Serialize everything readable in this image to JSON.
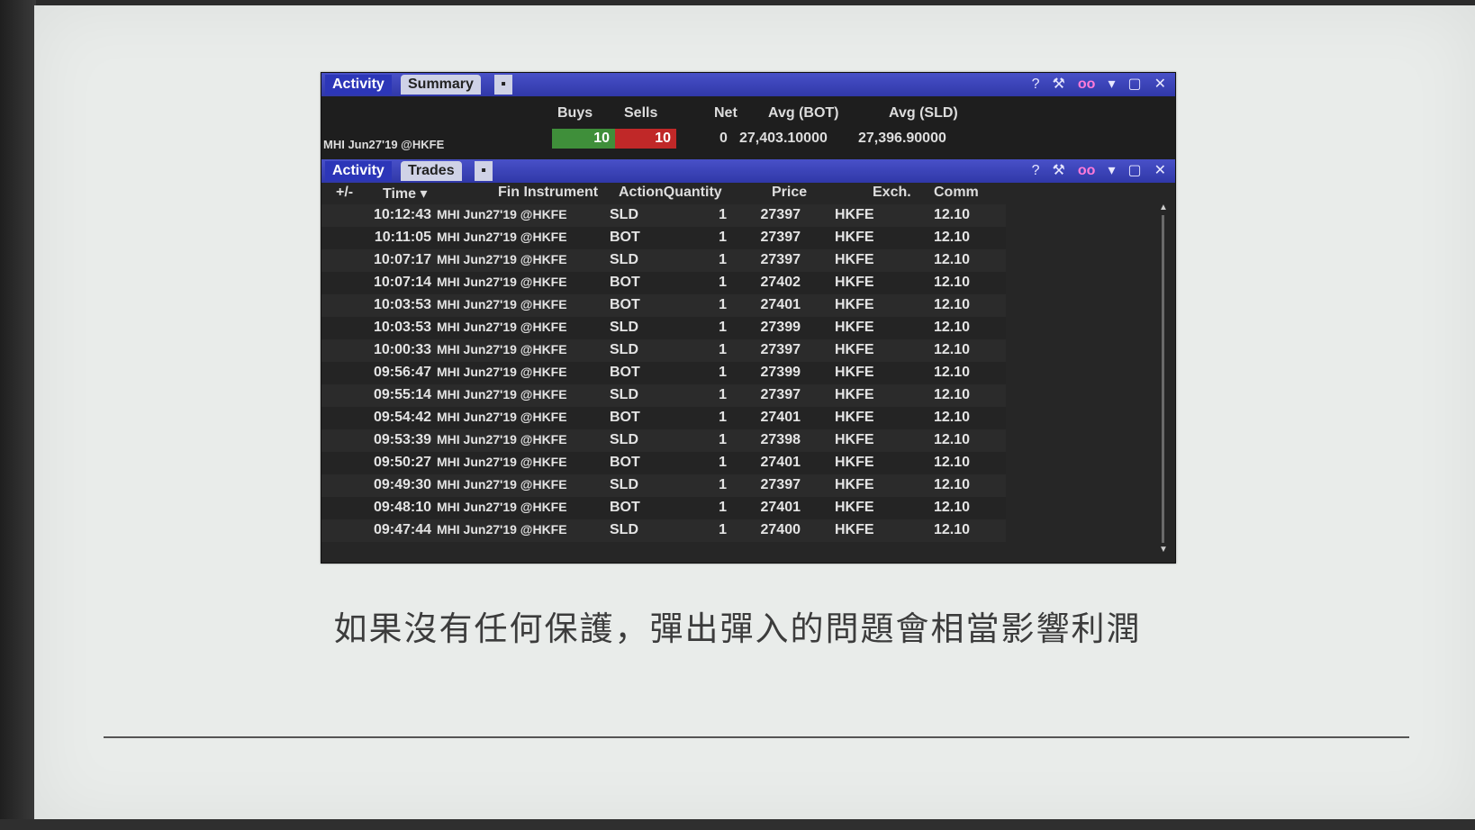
{
  "summary_panel": {
    "tabs": [
      "Activity",
      "Summary"
    ],
    "columns": {
      "buys": "Buys",
      "sells": "Sells",
      "net": "Net",
      "avg_bot": "Avg (BOT)",
      "avg_sld": "Avg (SLD)"
    },
    "row": {
      "instrument": "MHI Jun27'19 @HKFE",
      "buys": "10",
      "sells": "10",
      "net": "0",
      "avg_bot": "27,403.10000",
      "avg_sld": "27,396.90000"
    }
  },
  "header_icons": {
    "help": "?",
    "wrench": "🔧",
    "link": "oo",
    "dropdown": "▾",
    "expand": "⛶",
    "close": "✕"
  },
  "trades_panel": {
    "tabs": [
      "Activity",
      "Trades"
    ],
    "columns": {
      "pm": "+/-",
      "time": "Time ▾",
      "instrument": "Fin Instrument",
      "action_qty": "ActionQuantity",
      "price": "Price",
      "exch": "Exch.",
      "comm": "Comm"
    },
    "rows": [
      {
        "time": "10:12:43",
        "instrument": "MHI Jun27'19 @HKFE",
        "action": "SLD",
        "qty": "1",
        "price": "27397",
        "exch": "HKFE",
        "comm": "12.10"
      },
      {
        "time": "10:11:05",
        "instrument": "MHI Jun27'19 @HKFE",
        "action": "BOT",
        "qty": "1",
        "price": "27397",
        "exch": "HKFE",
        "comm": "12.10"
      },
      {
        "time": "10:07:17",
        "instrument": "MHI Jun27'19 @HKFE",
        "action": "SLD",
        "qty": "1",
        "price": "27397",
        "exch": "HKFE",
        "comm": "12.10"
      },
      {
        "time": "10:07:14",
        "instrument": "MHI Jun27'19 @HKFE",
        "action": "BOT",
        "qty": "1",
        "price": "27402",
        "exch": "HKFE",
        "comm": "12.10"
      },
      {
        "time": "10:03:53",
        "instrument": "MHI Jun27'19 @HKFE",
        "action": "BOT",
        "qty": "1",
        "price": "27401",
        "exch": "HKFE",
        "comm": "12.10"
      },
      {
        "time": "10:03:53",
        "instrument": "MHI Jun27'19 @HKFE",
        "action": "SLD",
        "qty": "1",
        "price": "27399",
        "exch": "HKFE",
        "comm": "12.10"
      },
      {
        "time": "10:00:33",
        "instrument": "MHI Jun27'19 @HKFE",
        "action": "SLD",
        "qty": "1",
        "price": "27397",
        "exch": "HKFE",
        "comm": "12.10"
      },
      {
        "time": "09:56:47",
        "instrument": "MHI Jun27'19 @HKFE",
        "action": "BOT",
        "qty": "1",
        "price": "27399",
        "exch": "HKFE",
        "comm": "12.10"
      },
      {
        "time": "09:55:14",
        "instrument": "MHI Jun27'19 @HKFE",
        "action": "SLD",
        "qty": "1",
        "price": "27397",
        "exch": "HKFE",
        "comm": "12.10"
      },
      {
        "time": "09:54:42",
        "instrument": "MHI Jun27'19 @HKFE",
        "action": "BOT",
        "qty": "1",
        "price": "27401",
        "exch": "HKFE",
        "comm": "12.10"
      },
      {
        "time": "09:53:39",
        "instrument": "MHI Jun27'19 @HKFE",
        "action": "SLD",
        "qty": "1",
        "price": "27398",
        "exch": "HKFE",
        "comm": "12.10"
      },
      {
        "time": "09:50:27",
        "instrument": "MHI Jun27'19 @HKFE",
        "action": "BOT",
        "qty": "1",
        "price": "27401",
        "exch": "HKFE",
        "comm": "12.10"
      },
      {
        "time": "09:49:30",
        "instrument": "MHI Jun27'19 @HKFE",
        "action": "SLD",
        "qty": "1",
        "price": "27397",
        "exch": "HKFE",
        "comm": "12.10"
      },
      {
        "time": "09:48:10",
        "instrument": "MHI Jun27'19 @HKFE",
        "action": "BOT",
        "qty": "1",
        "price": "27401",
        "exch": "HKFE",
        "comm": "12.10"
      },
      {
        "time": "09:47:44",
        "instrument": "MHI Jun27'19 @HKFE",
        "action": "SLD",
        "qty": "1",
        "price": "27400",
        "exch": "HKFE",
        "comm": "12.10"
      }
    ]
  },
  "caption": "如果沒有任何保護，彈出彈入的問題會相當影響利潤",
  "colors": {
    "tab_blue": "#3038a8",
    "buys_green": "#3f8f3a",
    "sells_red": "#c02828",
    "slide_bg": "#e9ecea"
  }
}
